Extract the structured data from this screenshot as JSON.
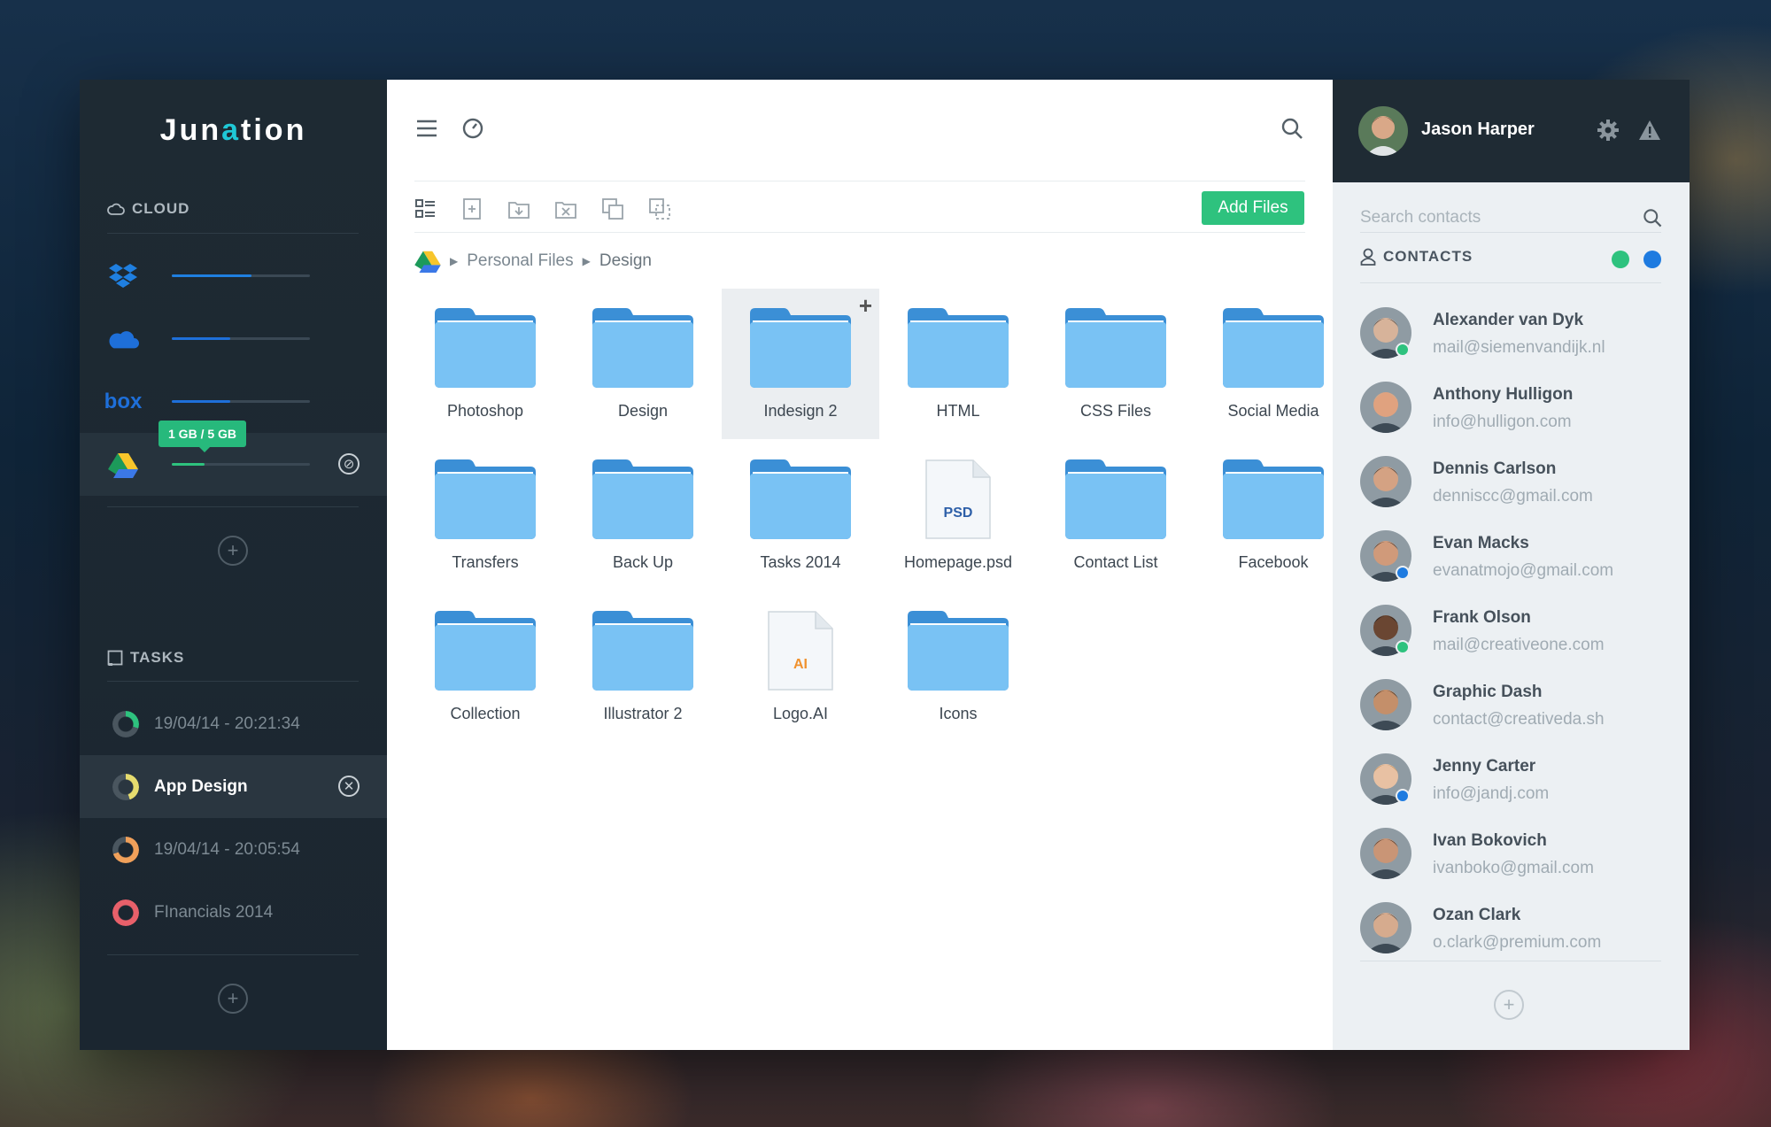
{
  "brand": {
    "logo_text_a": "Jun",
    "logo_text_q": "a",
    "logo_text_b": "tion"
  },
  "sidebar": {
    "cloud_heading": "CLOUD",
    "services": [
      {
        "name": "dropbox",
        "icon": "dropbox-icon",
        "usage": 0.58,
        "color": "#1f7fe0"
      },
      {
        "name": "onedrive",
        "icon": "onedrive-icon",
        "usage": 0.42,
        "color": "#1e6fd9"
      },
      {
        "name": "box",
        "icon": "box-icon",
        "usage": 0.42,
        "color": "#1e6fd9",
        "label": "box"
      },
      {
        "name": "google-drive",
        "icon": "google-drive-icon",
        "usage": 0.24,
        "color": "#2ec27e"
      }
    ],
    "storage_tooltip": "1 GB / 5 GB",
    "tasks_heading": "TASKS",
    "tasks": [
      {
        "label": "19/04/14 - 20:21:34",
        "ring_color": "#2ec27e",
        "progress": 0.3
      },
      {
        "label": "App Design",
        "ring_color": "#e6dc6e",
        "progress": 0.45
      },
      {
        "label": "19/04/14 - 20:05:54",
        "ring_color": "#f0a05a",
        "progress": 0.7
      },
      {
        "label": "FInancials 2014",
        "ring_color": "#e8606a",
        "progress": 1.0
      }
    ]
  },
  "main": {
    "add_files_label": "Add Files",
    "breadcrumb": [
      "Personal Files",
      "Design"
    ],
    "items": [
      {
        "label": "Photoshop",
        "kind": "folder"
      },
      {
        "label": "Design",
        "kind": "folder"
      },
      {
        "label": "Indesign 2",
        "kind": "folder",
        "selected": true
      },
      {
        "label": "HTML",
        "kind": "folder"
      },
      {
        "label": "CSS Files",
        "kind": "folder"
      },
      {
        "label": "Social Media",
        "kind": "folder"
      },
      {
        "label": "Transfers",
        "kind": "folder"
      },
      {
        "label": "Back Up",
        "kind": "folder"
      },
      {
        "label": "Tasks 2014",
        "kind": "folder"
      },
      {
        "label": "Homepage.psd",
        "kind": "file",
        "badge": "PSD",
        "badge_color": "#2d5fa8"
      },
      {
        "label": "Contact List",
        "kind": "folder"
      },
      {
        "label": "Facebook",
        "kind": "folder"
      },
      {
        "label": "Collection",
        "kind": "folder"
      },
      {
        "label": "Illustrator 2",
        "kind": "folder"
      },
      {
        "label": "Logo.AI",
        "kind": "file",
        "badge": "AI",
        "badge_color": "#f0922e"
      },
      {
        "label": "Icons",
        "kind": "folder"
      }
    ]
  },
  "profile": {
    "name": "Jason Harper"
  },
  "contacts": {
    "search_placeholder": "Search contacts",
    "heading": "CONTACTS",
    "filter_colors": [
      "#2ec27e",
      "#1e7be0"
    ],
    "list": [
      {
        "name": "Alexander van Dyk",
        "email": "mail@siemenvandijk.nl",
        "presence": "#2ec27e",
        "skin": "#d7b39a",
        "hair": "#3a3a3a"
      },
      {
        "name": "Anthony Hulligon",
        "email": "info@hulligon.com",
        "presence": null,
        "skin": "#e0a27f",
        "hair": "#c9b29a"
      },
      {
        "name": "Dennis Carlson",
        "email": "denniscc@gmail.com",
        "presence": null,
        "skin": "#d4a283",
        "hair": "#2a2a2a"
      },
      {
        "name": "Evan Macks",
        "email": "evanatmojo@gmail.com",
        "presence": "#1e7be0",
        "skin": "#d09a7a",
        "hair": "#2a2a2a"
      },
      {
        "name": "Frank Olson",
        "email": "mail@creativeone.com",
        "presence": "#2ec27e",
        "skin": "#6a4632",
        "hair": "#1a1a1a"
      },
      {
        "name": "Graphic Dash",
        "email": "contact@creativeda.sh",
        "presence": null,
        "skin": "#c48f6a",
        "hair": "#2b2018"
      },
      {
        "name": "Jenny Carter",
        "email": "info@jandj.com",
        "presence": "#1e7be0",
        "skin": "#e8c1a3",
        "hair": "#b88a55"
      },
      {
        "name": "Ivan Bokovich",
        "email": "ivanboko@gmail.com",
        "presence": null,
        "skin": "#c99576",
        "hair": "#3a2a20"
      },
      {
        "name": "Ozan Clark",
        "email": "o.clark@premium.com",
        "presence": null,
        "skin": "#d6ab8e",
        "hair": "#3b3b3b"
      }
    ]
  }
}
